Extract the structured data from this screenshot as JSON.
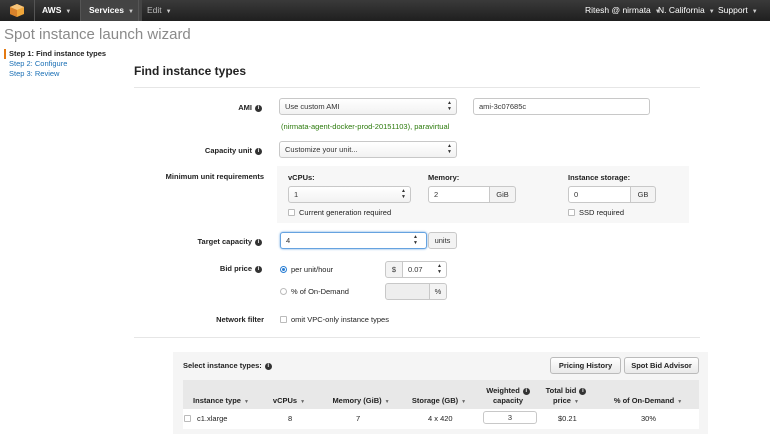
{
  "topnav": {
    "logo_icon": "aws-cube-icon",
    "aws_label": "AWS",
    "services_label": "Services",
    "edit_label": "Edit",
    "user_label": "Ritesh @ nirmata",
    "region_label": "N. California",
    "support_label": "Support"
  },
  "wizard": {
    "title": "Spot instance launch wizard",
    "steps": [
      "Step 1: Find instance types",
      "Step 2: Configure",
      "Step 3: Review"
    ]
  },
  "main": {
    "heading": "Find instance types",
    "ami": {
      "label": "AMI",
      "select_value": "Use custom AMI",
      "ami_id": "ami-3c07685c",
      "ami_description": "(nirmata-agent-docker-prod-20151103), paravirtual"
    },
    "capacity_unit": {
      "label": "Capacity unit",
      "select_value": "Customize your unit..."
    },
    "min_unit": {
      "label": "Minimum unit requirements",
      "vcpus_label": "vCPUs:",
      "vcpus_value": "1",
      "current_gen_label": "Current generation required",
      "memory_label": "Memory:",
      "memory_value": "2",
      "memory_unit": "GiB",
      "storage_label": "Instance storage:",
      "storage_value": "0",
      "storage_unit": "GB",
      "ssd_label": "SSD required"
    },
    "target_capacity": {
      "label": "Target capacity",
      "value": "4",
      "unit": "units"
    },
    "bid_price": {
      "label": "Bid price",
      "option1_label": "per unit/hour",
      "currency": "$",
      "option1_value": "0.07",
      "option2_label": "% of On-Demand",
      "option2_unit": "%"
    },
    "network_filter": {
      "label": "Network filter",
      "option_label": "omit VPC-only instance types"
    }
  },
  "instances": {
    "section_label": "Select instance types:",
    "pricing_history_button": "Pricing History",
    "spot_bid_advisor_button": "Spot Bid Advisor",
    "columns": {
      "instance_type": "Instance type",
      "vcpus": "vCPUs",
      "memory": "Memory (GiB)",
      "storage": "Storage (GB)",
      "weighted_capacity_1": "Weighted",
      "weighted_capacity_2": "capacity",
      "total_bid_1": "Total bid",
      "total_bid_2": "price",
      "pct_on_demand": "% of On-Demand"
    },
    "rows": [
      {
        "instance_type": "c1.xlarge",
        "vcpus": "8",
        "memory": "7",
        "storage": "4 x 420",
        "weighted_capacity": "3",
        "total_bid": "$0.21",
        "pct_on_demand": "30%"
      }
    ]
  },
  "colors": {
    "nav_bg": "#232f3e",
    "link": "#1a6fb5",
    "accent": "#e47911",
    "ami_desc": "#2b7a0b"
  }
}
